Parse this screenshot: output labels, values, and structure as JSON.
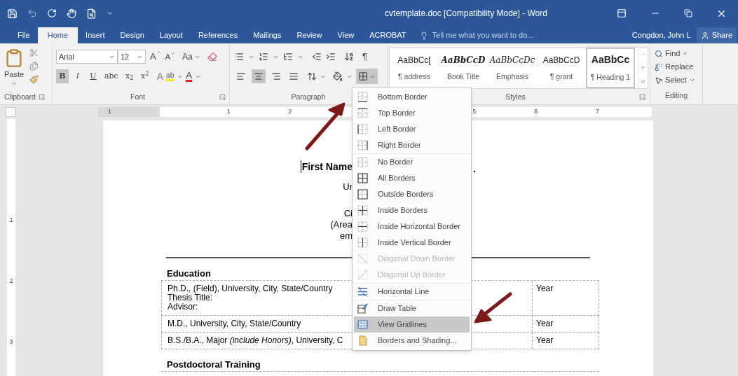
{
  "title_bar": {
    "title": "cvtemplate.doc [Compatibility Mode] - Word"
  },
  "tabs": [
    {
      "label": "File",
      "selected": false
    },
    {
      "label": "Home",
      "selected": true
    },
    {
      "label": "Insert",
      "selected": false
    },
    {
      "label": "Design",
      "selected": false
    },
    {
      "label": "Layout",
      "selected": false
    },
    {
      "label": "References",
      "selected": false
    },
    {
      "label": "Mailings",
      "selected": false
    },
    {
      "label": "Review",
      "selected": false
    },
    {
      "label": "View",
      "selected": false
    },
    {
      "label": "ACROBAT",
      "selected": false
    }
  ],
  "tell_me": {
    "placeholder": "Tell me what you want to do..."
  },
  "account": {
    "user": "Congdon, John L",
    "share": "Share"
  },
  "clipboard": {
    "paste": "Paste",
    "label": "Clipboard"
  },
  "font": {
    "name": "Arial",
    "size": "12",
    "grow": "A",
    "shrink": "A",
    "change_case": "Aa",
    "format_buttons": [
      {
        "label": "B",
        "on": true
      },
      {
        "label": "I",
        "on": false
      },
      {
        "label": "U",
        "on": false
      },
      {
        "label": "abc",
        "on": false
      },
      {
        "label": "x$_{2}$",
        "on": false
      },
      {
        "label": "x$^{2}$",
        "on": false
      }
    ],
    "effects": "A",
    "highlight": "ab",
    "font_color": "A",
    "label": "Font"
  },
  "paragraph": {
    "show_marks": "¶",
    "alignment": [
      {
        "selected": false
      },
      {
        "selected": true
      },
      {
        "selected": false
      },
      {
        "selected": false
      }
    ],
    "borders_expanded": true,
    "label": "Paragraph"
  },
  "styles": {
    "items": [
      {
        "preview": "AaBbCc[",
        "name": "¶ address",
        "selected": false
      },
      {
        "preview": "AaBbCcD",
        "name": "Book Title",
        "selected": false
      },
      {
        "preview": "AaBbCcDc",
        "name": "Emphasis",
        "selected": false
      },
      {
        "preview": "AaBbCcD",
        "name": "¶ grant",
        "selected": false
      },
      {
        "preview": "AaBbCc",
        "name": "¶ Heading 1",
        "selected": true
      }
    ],
    "label": "Styles"
  },
  "editing": {
    "find": "Find",
    "replace": "Replace",
    "select": "Select",
    "label": "Editing"
  },
  "ruler": [
    "1",
    "1",
    "2",
    "5",
    "6",
    "7"
  ],
  "vertical_ruler": [
    "1",
    "2",
    "3"
  ],
  "document": {
    "name_heading": {
      "left": "First Name",
      "right": "."
    },
    "address_blocks": [
      [
        "Ur"
      ],
      [
        "Ci",
        "(Area",
        "em"
      ]
    ],
    "sections": [
      {
        "heading": "Education",
        "rows": [
          {
            "lines": [
              "Ph.D., (Field), University, City, State/Country",
              "Thesis Title:",
              "Advisor:"
            ],
            "year": "Year"
          },
          {
            "lines": [
              "M.D., University, City, State/Country"
            ],
            "year": "Year"
          },
          {
            "lines": [
              "B.S./B.A., Major *(include Honors)*, University, C"
            ],
            "year": "Year"
          }
        ]
      },
      {
        "heading": "Postdoctoral Training"
      }
    ]
  },
  "border_menu": {
    "groups": [
      [
        {
          "label": "Bottom Border",
          "disabled": false,
          "selected": false
        },
        {
          "label": "Top Border",
          "disabled": false,
          "selected": false
        },
        {
          "label": "Left Border",
          "disabled": false,
          "selected": false
        },
        {
          "label": "Right Border",
          "disabled": false,
          "selected": false
        }
      ],
      [
        {
          "label": "No Border",
          "disabled": false,
          "selected": false
        },
        {
          "label": "All Borders",
          "disabled": false,
          "selected": false
        },
        {
          "label": "Outside Borders",
          "disabled": false,
          "selected": false
        },
        {
          "label": "Inside Borders",
          "disabled": false,
          "selected": false
        },
        {
          "label": "Inside Horizontal Border",
          "disabled": false,
          "selected": false
        },
        {
          "label": "Inside Vertical Border",
          "disabled": false,
          "selected": false
        },
        {
          "label": "Diagonal Down Border",
          "disabled": true,
          "selected": false
        },
        {
          "label": "Diagonal Up Border",
          "disabled": true,
          "selected": false
        }
      ],
      [
        {
          "label": "Horizontal Line",
          "disabled": false,
          "selected": false
        }
      ],
      [
        {
          "label": "Draw Table",
          "disabled": false,
          "selected": false
        },
        {
          "label": "View Gridlines",
          "disabled": false,
          "selected": true
        },
        {
          "label": "Borders and Shading...",
          "disabled": false,
          "selected": false
        }
      ]
    ]
  }
}
